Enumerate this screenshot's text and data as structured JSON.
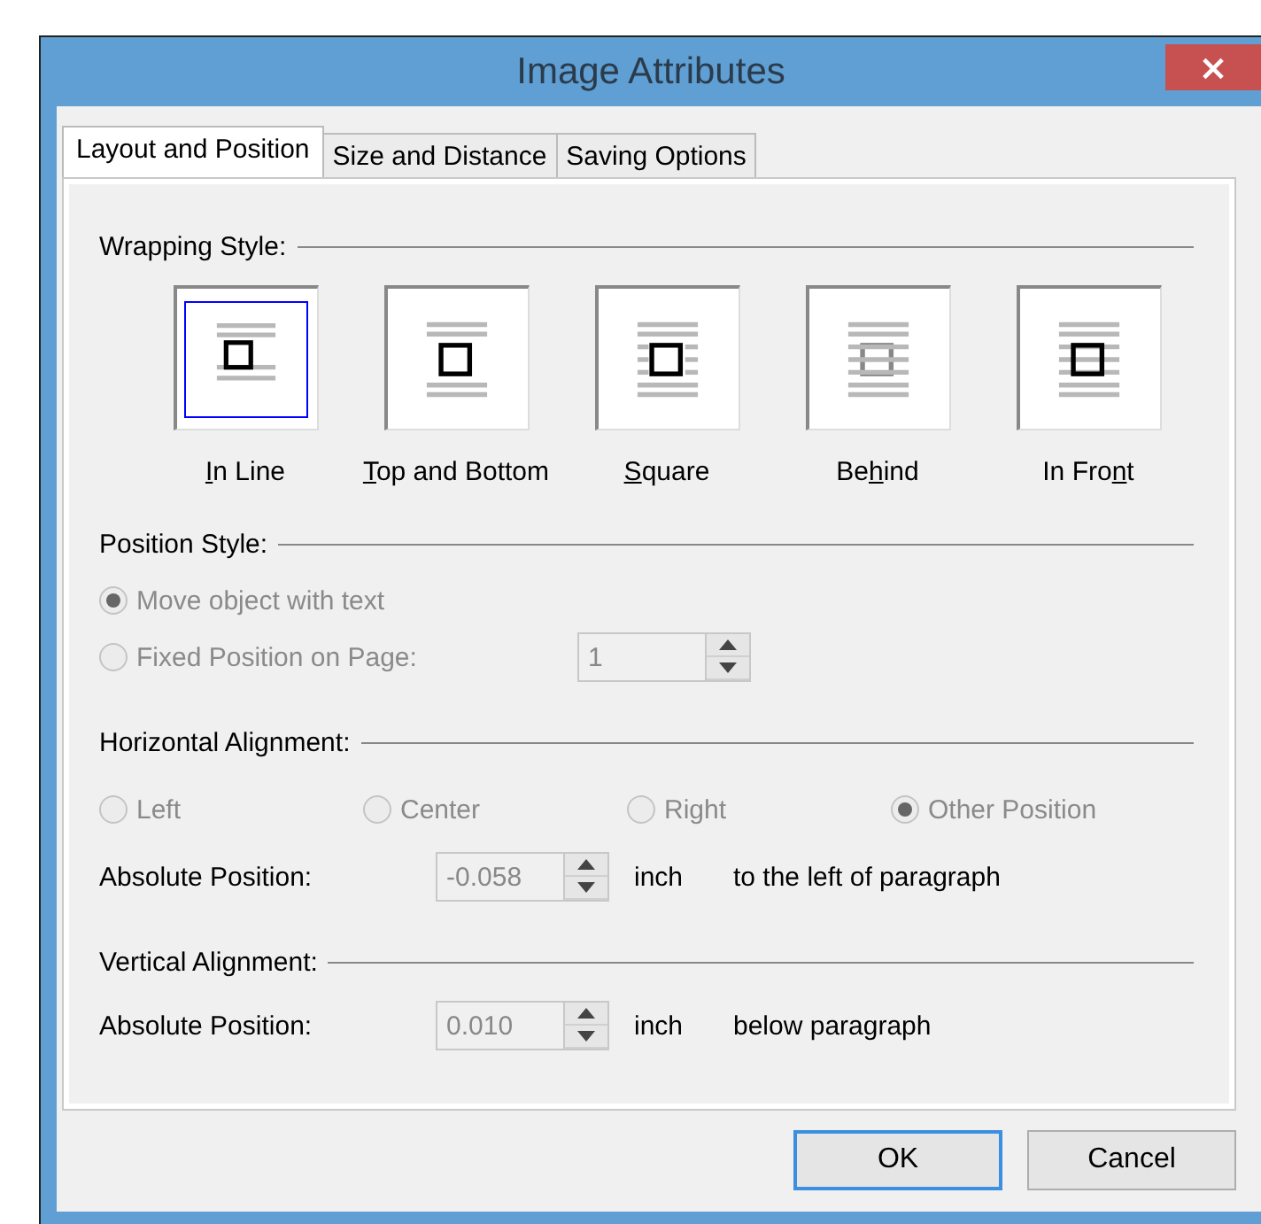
{
  "window": {
    "title": "Image Attributes",
    "close": "×"
  },
  "tabs": [
    {
      "label": "Layout and Position",
      "selected": true
    },
    {
      "label": "Size and Distance",
      "selected": false
    },
    {
      "label": "Saving Options",
      "selected": false
    }
  ],
  "wrapping_style": {
    "title": "Wrapping Style:",
    "options": [
      {
        "label_parts": {
          "key": "I",
          "after": "n Line"
        },
        "kind": "inline",
        "selected": true
      },
      {
        "label_parts": {
          "key": "T",
          "after": "op and Bottom"
        },
        "kind": "topbottom",
        "selected": false
      },
      {
        "label_parts": {
          "key": "S",
          "after": "quare"
        },
        "kind": "square",
        "selected": false
      },
      {
        "label_parts": {
          "before": "Be",
          "key": "h",
          "after": "ind"
        },
        "kind": "behind",
        "selected": false
      },
      {
        "label_parts": {
          "before": "In Fro",
          "key": "n",
          "after": "t"
        },
        "kind": "front",
        "selected": false
      }
    ]
  },
  "position_style": {
    "title": "Position Style:",
    "options": [
      {
        "label": "Move object with text",
        "selected": true,
        "disabled": true
      },
      {
        "label": "Fixed Position on Page:",
        "selected": false,
        "disabled": true
      }
    ],
    "page_field": {
      "value": "1",
      "disabled": true
    }
  },
  "horizontal_alignment": {
    "title": "Horizontal Alignment:",
    "options": [
      {
        "label": "Left",
        "selected": false,
        "disabled": true
      },
      {
        "label": "Center",
        "selected": false,
        "disabled": true
      },
      {
        "label": "Right",
        "selected": false,
        "disabled": true
      },
      {
        "label": "Other Position",
        "selected": true,
        "disabled": true
      }
    ],
    "position": {
      "label": "Absolute Position:",
      "value": "-0.058",
      "disabled": true,
      "unit": "inch",
      "suffix": "to the left of paragraph"
    }
  },
  "vertical_alignment": {
    "title": "Vertical Alignment:",
    "position": {
      "label": "Absolute Position:",
      "value": "0.010",
      "disabled": true,
      "unit": "inch",
      "suffix": "below paragraph"
    }
  },
  "buttons": [
    {
      "label": "OK",
      "default": true
    },
    {
      "label": "Cancel",
      "default": false
    }
  ]
}
